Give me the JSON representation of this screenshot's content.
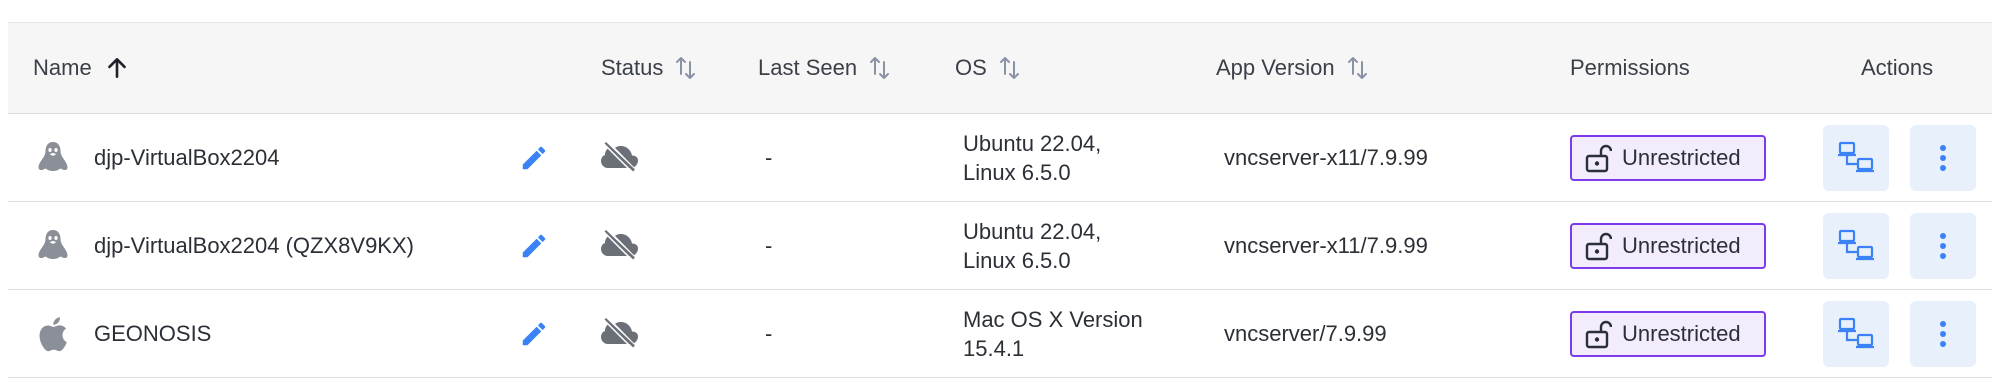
{
  "table": {
    "columns": {
      "name": "Name",
      "status": "Status",
      "last_seen": "Last Seen",
      "os": "OS",
      "app_version": "App Version",
      "permissions": "Permissions",
      "actions": "Actions"
    },
    "rows": [
      {
        "os_icon": "linux-tux-icon",
        "name": "djp-VirtualBox2204",
        "status_icon": "cloud-off-icon",
        "last_seen": "-",
        "os_line1": "Ubuntu 22.04,",
        "os_line2": "Linux 6.5.0",
        "app_version": "vncserver-x11/7.9.99",
        "permission": "Unrestricted"
      },
      {
        "os_icon": "linux-tux-icon",
        "name": "djp-VirtualBox2204 (QZX8V9KX)",
        "status_icon": "cloud-off-icon",
        "last_seen": "-",
        "os_line1": "Ubuntu 22.04,",
        "os_line2": "Linux 6.5.0",
        "app_version": "vncserver-x11/7.9.99",
        "permission": "Unrestricted"
      },
      {
        "os_icon": "apple-icon",
        "name": "GEONOSIS",
        "status_icon": "cloud-off-icon",
        "last_seen": "-",
        "os_line1": "Mac OS X Version",
        "os_line2": "15.4.1",
        "app_version": "vncserver/7.9.99",
        "permission": "Unrestricted"
      }
    ]
  },
  "colors": {
    "accent_blue": "#3b82f6",
    "permission_border": "#7c3aed",
    "permission_bg": "#f3ecfd",
    "action_bg": "#e8f0fb",
    "icon_gray": "#8a8f98"
  }
}
